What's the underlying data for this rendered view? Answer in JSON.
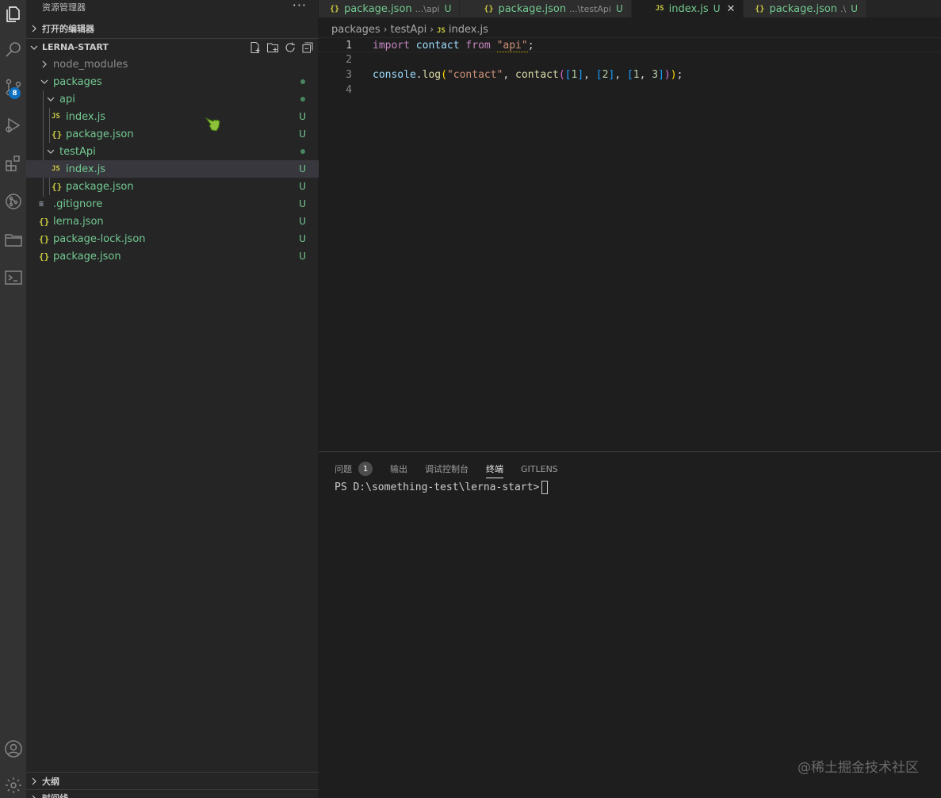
{
  "sidebar": {
    "title": "资源管理器",
    "more_label": "···",
    "open_editors_label": "打开的编辑器",
    "project_label": "LERNA-START",
    "outline_label": "大纲",
    "timeline_label": "时间线",
    "tree": [
      {
        "label": "node_modules",
        "type": "folder",
        "status": ""
      },
      {
        "label": "packages",
        "type": "folder",
        "status": "dot"
      },
      {
        "label": "api",
        "type": "folder",
        "status": "dot"
      },
      {
        "label": "index.js",
        "type": "js",
        "status": "U"
      },
      {
        "label": "package.json",
        "type": "json",
        "status": "U"
      },
      {
        "label": "testApi",
        "type": "folder",
        "status": "dot"
      },
      {
        "label": "index.js",
        "type": "js",
        "status": "U"
      },
      {
        "label": "package.json",
        "type": "json",
        "status": "U"
      },
      {
        "label": ".gitignore",
        "type": "git",
        "status": "U"
      },
      {
        "label": "lerna.json",
        "type": "json",
        "status": "U"
      },
      {
        "label": "package-lock.json",
        "type": "json",
        "status": "U"
      },
      {
        "label": "package.json",
        "type": "json",
        "status": "U"
      }
    ]
  },
  "activity": {
    "scm_badge": "8"
  },
  "tabs": [
    {
      "icon": "{}",
      "name": "package.json",
      "desc": "...\\api",
      "status": "U"
    },
    {
      "icon": "{}",
      "name": "package.json",
      "desc": "...\\testApi",
      "status": "U"
    },
    {
      "icon": "JS",
      "name": "index.js",
      "desc": "",
      "status": "U",
      "close": "✕"
    },
    {
      "icon": "{}",
      "name": "package.json",
      "desc": ".\\",
      "status": "U"
    }
  ],
  "breadcrumbs": {
    "part1": "packages",
    "part2": "testApi",
    "icon": "JS",
    "file": "index.js"
  },
  "code": {
    "line_numbers": [
      "1",
      "2",
      "3",
      "4"
    ],
    "l1_import": "import",
    "l1_contact": "contact",
    "l1_from": "from",
    "l1_str": "\"api\"",
    "l1_semi": ";",
    "l3_console": "console",
    "l3_dot": ".",
    "l3_log": "log",
    "l3_str": "\"contact\"",
    "l3_contact": "contact",
    "l3_n1": "1",
    "l3_n2": "2",
    "l3_n3": "1",
    "l3_n4": "3"
  },
  "panel": {
    "tabs": [
      "问题",
      "输出",
      "调试控制台",
      "终端",
      "GITLENS"
    ],
    "problems_count": "1",
    "active_tab": "终端",
    "terminal_prompt": "PS D:\\something-test\\lerna-start>"
  },
  "watermark": "@稀土掘金技术社区",
  "colors": {
    "activity_bg": "#333333",
    "sidebar_bg": "#252526",
    "editor_bg": "#1e1e1e",
    "untracked_green": "#73c991",
    "badge_blue": "#0e70c0"
  }
}
